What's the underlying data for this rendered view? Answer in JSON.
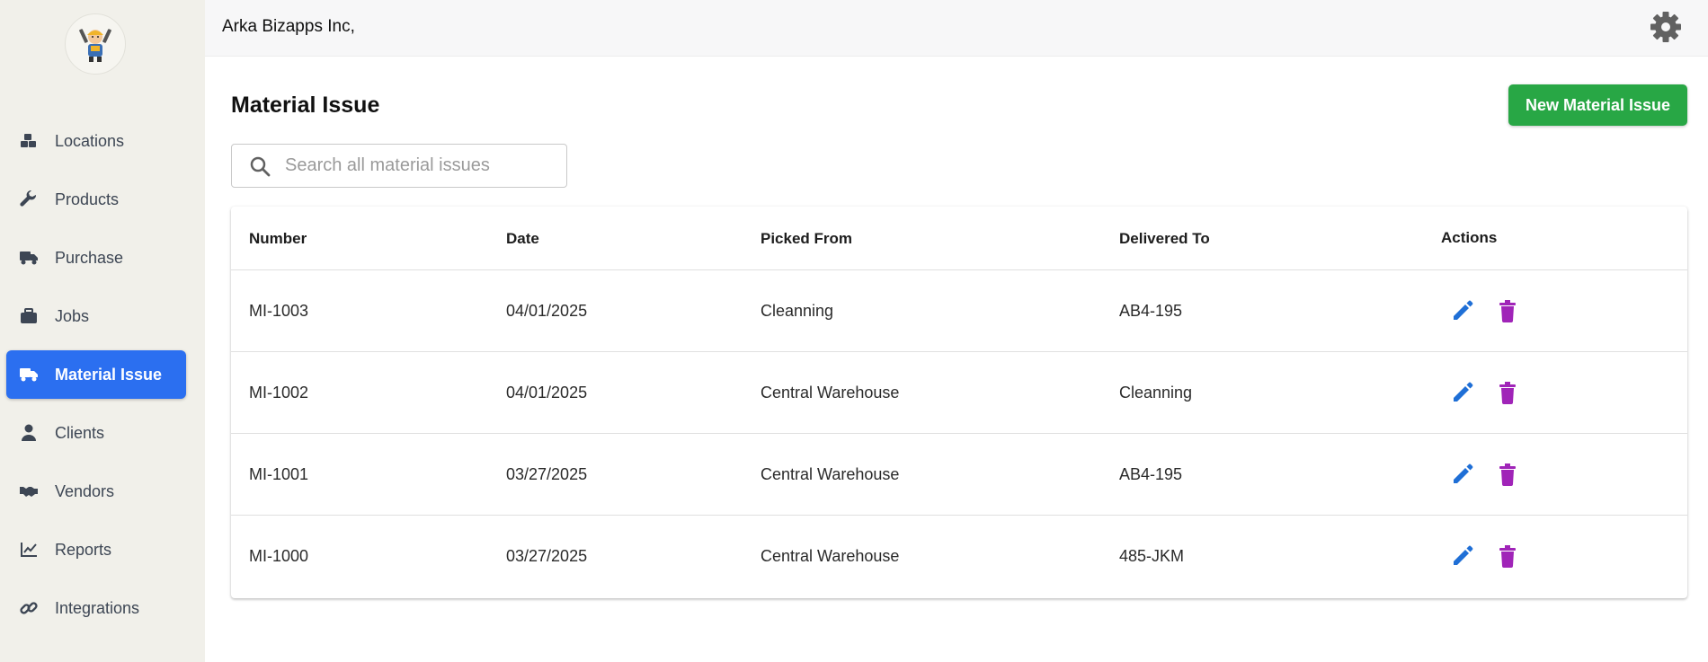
{
  "sidebar": {
    "logo_icon": "worker-mascot-icon",
    "items": [
      {
        "label": "Locations",
        "icon": "cubes-icon",
        "active": false
      },
      {
        "label": "Products",
        "icon": "wrench-icon",
        "active": false
      },
      {
        "label": "Purchase",
        "icon": "truck-icon",
        "active": false
      },
      {
        "label": "Jobs",
        "icon": "briefcase-icon",
        "active": false
      },
      {
        "label": "Material Issue",
        "icon": "truck-icon",
        "active": true
      },
      {
        "label": "Clients",
        "icon": "user-icon",
        "active": false
      },
      {
        "label": "Vendors",
        "icon": "handshake-icon",
        "active": false
      },
      {
        "label": "Reports",
        "icon": "chart-line-icon",
        "active": false
      },
      {
        "label": "Integrations",
        "icon": "link-icon",
        "active": false
      }
    ]
  },
  "header": {
    "company": "Arka Bizapps Inc,",
    "settings_icon": "gear-icon"
  },
  "main": {
    "title": "Material Issue",
    "new_button": "New Material Issue",
    "search": {
      "placeholder": "Search all material issues",
      "value": ""
    },
    "table": {
      "columns": [
        "Number",
        "Date",
        "Picked From",
        "Delivered To",
        "Actions"
      ],
      "rows": [
        {
          "number": "MI-1003",
          "date": "04/01/2025",
          "picked_from": "Cleanning",
          "delivered_to": "AB4-195"
        },
        {
          "number": "MI-1002",
          "date": "04/01/2025",
          "picked_from": "Central Warehouse",
          "delivered_to": "Cleanning"
        },
        {
          "number": "MI-1001",
          "date": "03/27/2025",
          "picked_from": "Central Warehouse",
          "delivered_to": "AB4-195"
        },
        {
          "number": "MI-1000",
          "date": "03/27/2025",
          "picked_from": "Central Warehouse",
          "delivered_to": "485-JKM"
        }
      ]
    }
  },
  "colors": {
    "accent": "#2b6ff0",
    "success": "#28a745",
    "edit_icon": "#1f6fd6",
    "delete_icon": "#a024b8",
    "sidebar_bg": "#f1f0ea"
  }
}
